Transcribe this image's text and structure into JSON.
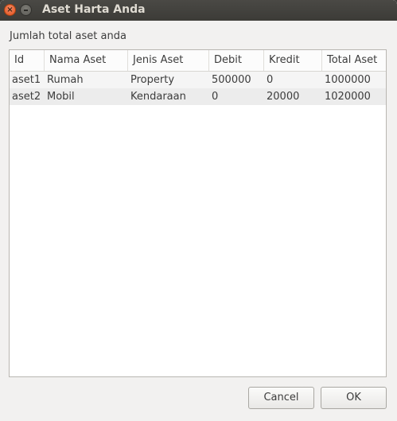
{
  "window": {
    "title": "Aset Harta Anda"
  },
  "heading": "Jumlah total aset anda",
  "table": {
    "columns": [
      "Id",
      "Nama Aset",
      "Jenis Aset",
      "Debit",
      "Kredit",
      "Total Aset"
    ],
    "rows": [
      [
        "aset1",
        "Rumah",
        "Property",
        "500000",
        "0",
        "1000000"
      ],
      [
        "aset2",
        "Mobil",
        "Kendaraan",
        "0",
        "20000",
        "1020000"
      ]
    ]
  },
  "buttons": {
    "cancel_label": "Cancel",
    "ok_label": "OK"
  },
  "icons": {
    "close": "close-icon",
    "minimize": "minimize-icon"
  },
  "colors": {
    "titlebar": "#3c3b37",
    "close_button": "#e2511f",
    "window_bg": "#f2f1f0"
  }
}
